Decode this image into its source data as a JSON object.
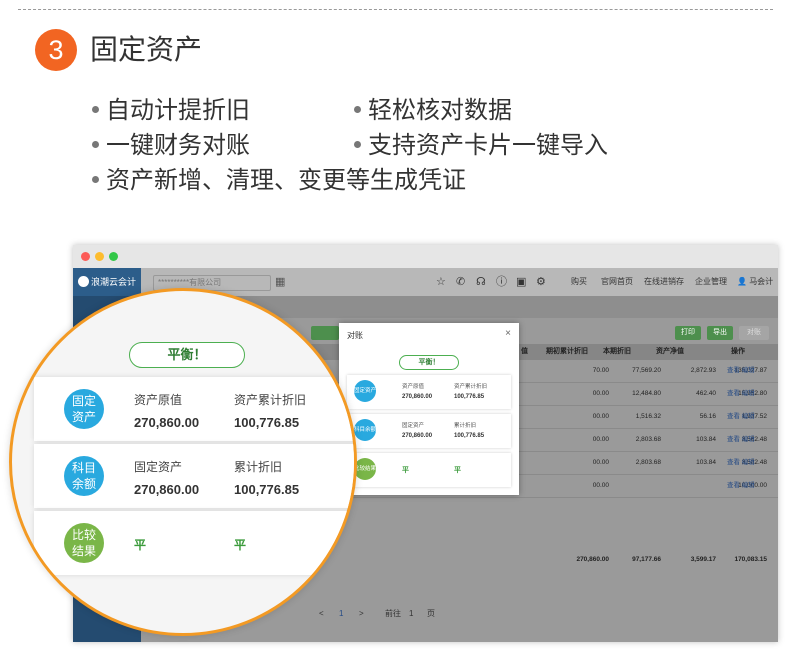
{
  "header": {
    "step_number": "3",
    "title": "固定资产"
  },
  "features": [
    "自动计提折旧",
    "轻松核对数据",
    "一键财务对账",
    "支持资产卡片一键导入",
    "资产新增、清理、变更等生成凭证"
  ],
  "app": {
    "brand": "浪潮云会计",
    "company_placeholder": "**********有限公司",
    "nav": [
      "购买",
      "官网首页",
      "在线进销存",
      "企业管理",
      "马会计"
    ],
    "buttons": {
      "print": "打印",
      "export": "导出",
      "other": "对账"
    },
    "columns": [
      "值",
      "期初累计折旧",
      "本期折旧",
      "资产净值",
      "操作"
    ],
    "rows": [
      {
        "orig": "70.00",
        "accum": "77,569.20",
        "current": "2,872.93",
        "net": "135,027.87",
        "ops": "查看 编辑"
      },
      {
        "orig": "00.00",
        "accum": "12,484.80",
        "current": "462.40",
        "net": "15,952.80",
        "ops": "查看 编辑"
      },
      {
        "orig": "00.00",
        "accum": "1,516.32",
        "current": "56.16",
        "net": "1,937.52",
        "ops": "查看 编辑"
      },
      {
        "orig": "00.00",
        "accum": "2,803.68",
        "current": "103.84",
        "net": "3,562.48",
        "ops": "查看 编辑"
      },
      {
        "orig": "00.00",
        "accum": "2,803.68",
        "current": "103.84",
        "net": "3,582.48",
        "ops": "查看 编辑"
      },
      {
        "orig": "00.00",
        "accum": "",
        "current": "",
        "net": "10,000.00",
        "ops": "查看 编辑"
      }
    ],
    "totals": {
      "orig": "270,860.00",
      "accum": "97,177.66",
      "current": "3,599.17",
      "net": "170,083.15"
    },
    "pager": {
      "prev": "<",
      "page": "1",
      "next": ">",
      "goto": "前往",
      "goto_page": "1",
      "page_unit": "页"
    }
  },
  "dialog": {
    "title": "对账",
    "close": "×",
    "balance": "平衡！",
    "cards": [
      {
        "badge": "固定资产",
        "label1": "资产原值",
        "label2": "资产累计折旧",
        "value1": "270,860.00",
        "value2": "100,776.85",
        "color": "#29a9df"
      },
      {
        "badge": "科目余额",
        "label1": "固定资产",
        "label2": "累计折旧",
        "value1": "270,860.00",
        "value2": "100,776.85",
        "color": "#29a9df"
      },
      {
        "badge": "比较结果",
        "label1": "平",
        "label2": "平",
        "color": "#7ab648"
      }
    ]
  },
  "magnifier": {
    "balance": "平衡！",
    "cards": [
      {
        "badge_line1": "固定",
        "badge_line2": "资产",
        "label1": "资产原值",
        "label2": "资产累计折旧",
        "value1": "270,860.00",
        "value2": "100,776.85",
        "color": "#29a9df"
      },
      {
        "badge_line1": "科目",
        "badge_line2": "余额",
        "label1": "固定资产",
        "label2": "累计折旧",
        "value1": "270,860.00",
        "value2": "100,776.85",
        "color": "#29a9df"
      },
      {
        "badge_line1": "比较",
        "badge_line2": "结果",
        "label1": "平",
        "label2": "平",
        "color": "#7ab648"
      }
    ]
  },
  "colors": {
    "accent": "#f26522",
    "ring": "#f39a24",
    "balance_green": "#4caf50",
    "badge_blue": "#29a9df",
    "badge_green": "#7ab648"
  }
}
